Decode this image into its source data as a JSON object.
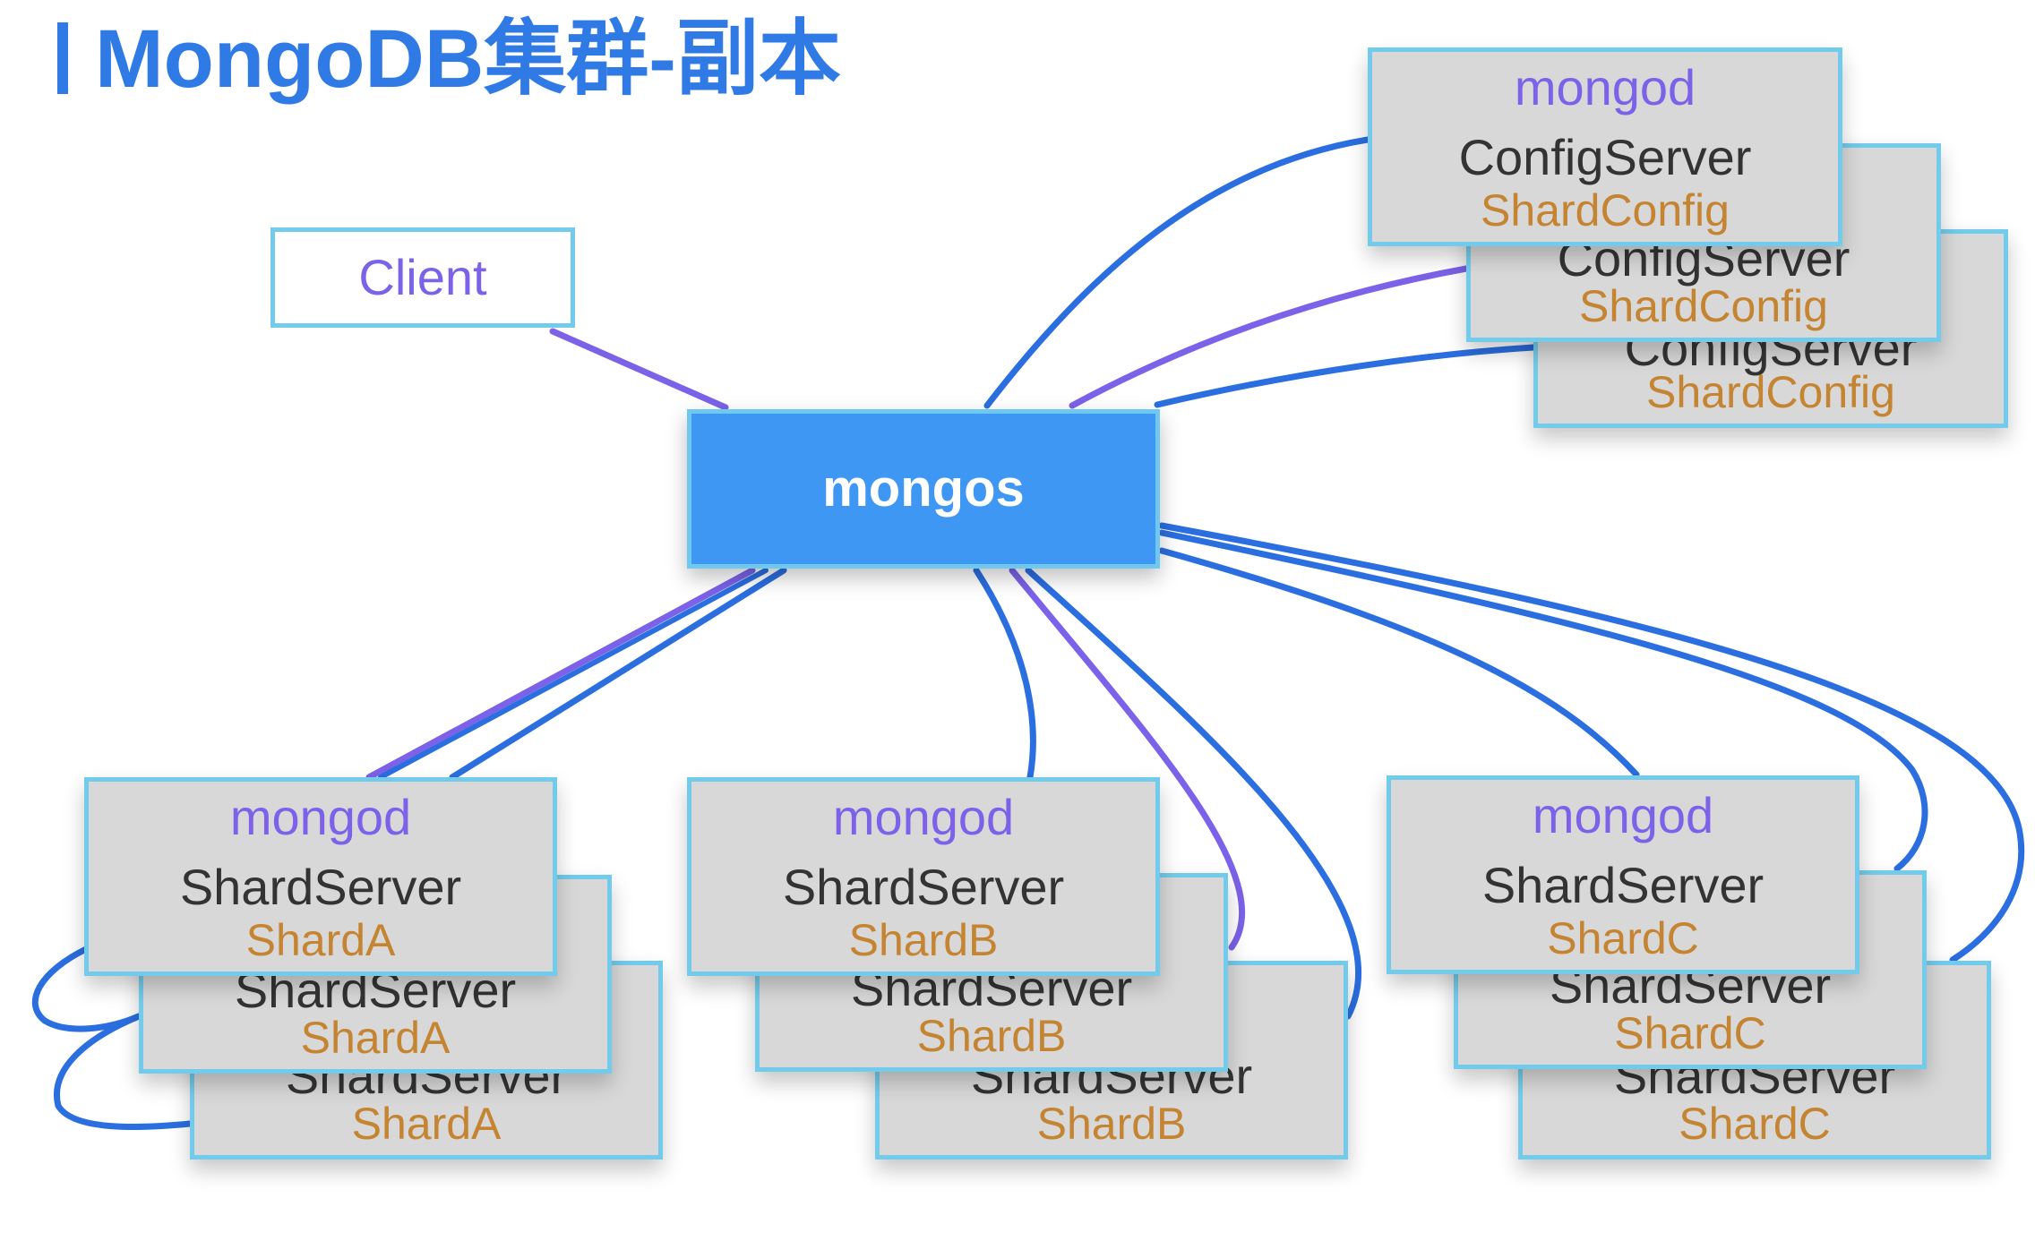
{
  "title": "MongoDB集群-副本",
  "colors": {
    "title": "#2f7ae5",
    "link_blue": "#2a6ee0",
    "link_purple": "#7b62e8",
    "node_fill": "#d8d8d8",
    "node_border": "#72cbea",
    "mongos_fill": "#3e97f2",
    "mongod_text": "#7b62e8",
    "role_text": "#333333",
    "name_text": "#c48431"
  },
  "client": {
    "label": "Client"
  },
  "mongos": {
    "label": "mongos"
  },
  "config": {
    "front": {
      "process": "mongod",
      "role": "ConfigServer",
      "name": "ShardConfig"
    },
    "replica2": {
      "role": "ConfigServer",
      "name": "ShardConfig"
    },
    "replica3": {
      "role": "ConfigServer",
      "name": "ShardConfig"
    }
  },
  "shard_a": {
    "front": {
      "process": "mongod",
      "role": "ShardServer",
      "name": "ShardA"
    },
    "replica2": {
      "role": "ShardServer",
      "name": "ShardA"
    },
    "replica3": {
      "role": "ShardServer",
      "name": "ShardA"
    }
  },
  "shard_b": {
    "front": {
      "process": "mongod",
      "role": "ShardServer",
      "name": "ShardB"
    },
    "replica2": {
      "role": "ShardServer",
      "name": "ShardB"
    },
    "replica3": {
      "role": "ShardServer",
      "name": "ShardB"
    }
  },
  "shard_c": {
    "front": {
      "process": "mongod",
      "role": "ShardServer",
      "name": "ShardC"
    },
    "replica2": {
      "role": "ShardServer",
      "name": "ShardC"
    },
    "replica3": {
      "role": "ShardServer",
      "name": "ShardC"
    }
  }
}
